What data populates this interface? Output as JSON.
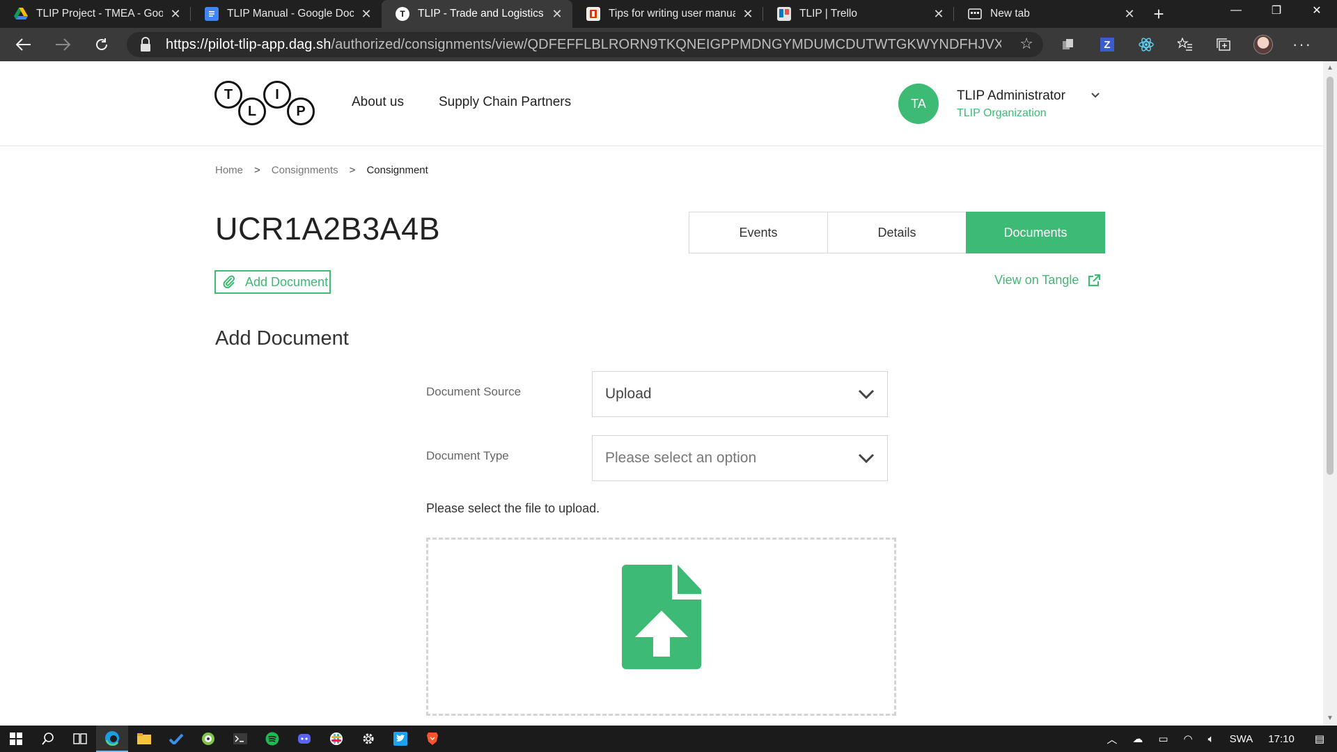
{
  "browser": {
    "tabs": [
      {
        "title": "TLIP Project - TMEA - Google",
        "favicon": "google-drive-icon",
        "active": false
      },
      {
        "title": "TLIP Manual - Google Docs",
        "favicon": "google-docs-icon",
        "active": false
      },
      {
        "title": "TLIP - Trade and Logistics Inf",
        "favicon": "tlip-icon",
        "active": true
      },
      {
        "title": "Tips for writing user manuals",
        "favicon": "office-icon",
        "active": false
      },
      {
        "title": "TLIP | Trello",
        "favicon": "trello-icon",
        "active": false
      },
      {
        "title": "New tab",
        "favicon": "new-tab-icon",
        "active": false
      }
    ],
    "url_host": "https://pilot-tlip-app.dag.sh",
    "url_path": "/authorized/consignments/view/QDFEFFLBLRORN9TKQNEIGPPMDNGYMDUMCDUTWTGKWYNDFHJVXVXJ...",
    "colors": {
      "tabbar": "#202020",
      "toolbar": "#3a3a3a"
    }
  },
  "site": {
    "logo_letters": [
      "T",
      "L",
      "I",
      "P"
    ],
    "nav": [
      "About us",
      "Supply Chain Partners"
    ],
    "user": {
      "initials": "TA",
      "name": "TLIP Administrator",
      "org": "TLIP Organization"
    },
    "accent": "#3dba74"
  },
  "breadcrumb": {
    "items": [
      "Home",
      "Consignments",
      "Consignment"
    ],
    "separator": ">"
  },
  "consignment": {
    "title": "UCR1A2B3A4B"
  },
  "page_tabs": [
    {
      "label": "Events",
      "active": false
    },
    {
      "label": "Details",
      "active": false
    },
    {
      "label": "Documents",
      "active": true
    }
  ],
  "actions": {
    "add_document": "Add Document",
    "view_on_tangle": "View on Tangle"
  },
  "form": {
    "section_title": "Add Document",
    "source_label": "Document Source",
    "source_value": "Upload",
    "type_label": "Document Type",
    "type_placeholder": "Please select an option",
    "upload_hint": "Please select the file to upload."
  },
  "taskbar": {
    "apps": [
      "edge-icon",
      "file-explorer-icon",
      "todo-icon",
      "tor-icon",
      "terminal-icon",
      "spotify-icon",
      "discord-icon",
      "slack-icon",
      "settings-icon",
      "twitter-icon",
      "brave-icon"
    ],
    "language": "SWA",
    "time": "17:10"
  }
}
